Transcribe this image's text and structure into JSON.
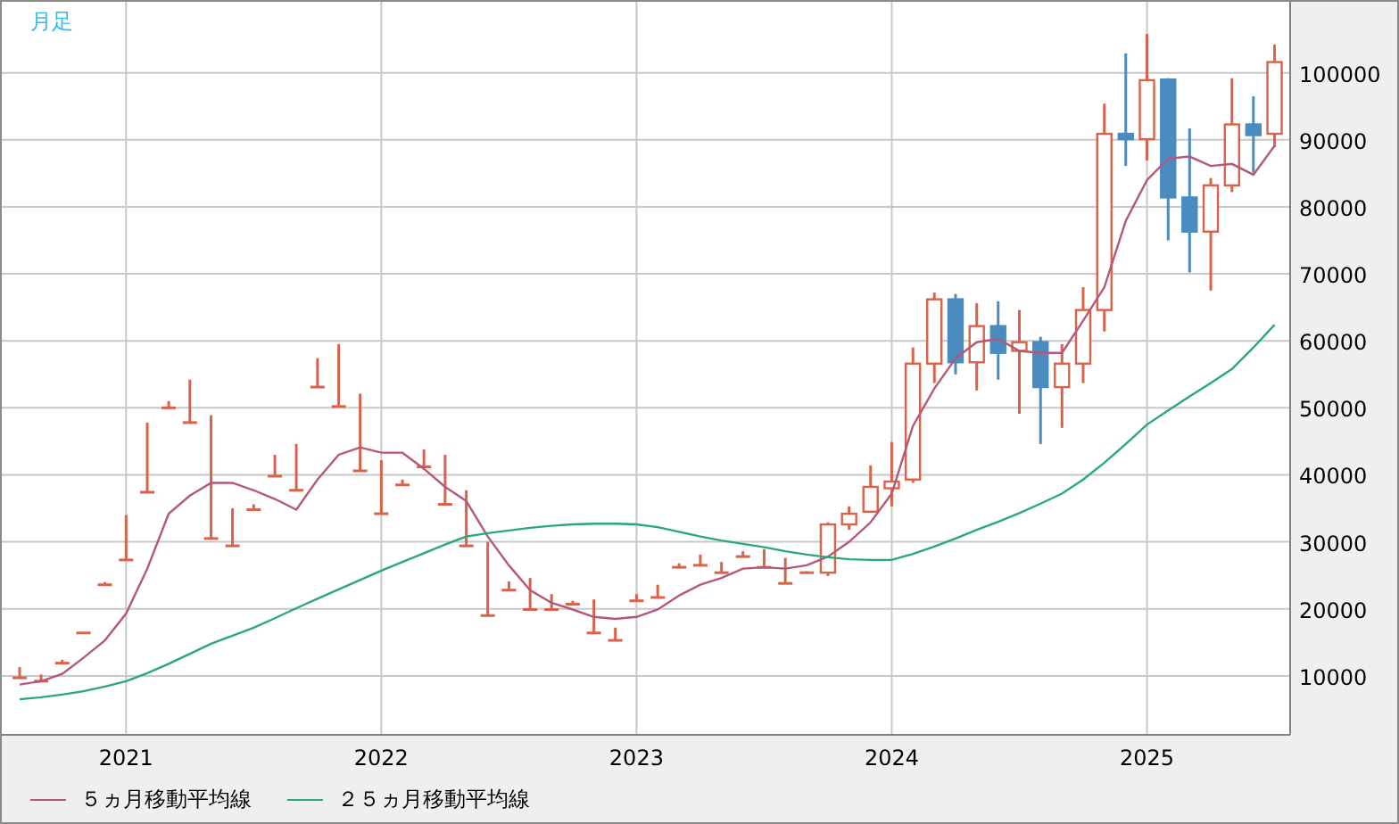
{
  "chart_title": "月足",
  "chart_data": {
    "type": "candlestick",
    "grid": true,
    "x": [
      2020.583,
      2020.667,
      2020.75,
      2020.833,
      2020.917,
      2021,
      2021.083,
      2021.167,
      2021.25,
      2021.333,
      2021.417,
      2021.5,
      2021.583,
      2021.667,
      2021.75,
      2021.833,
      2021.917,
      2022,
      2022.083,
      2022.167,
      2022.25,
      2022.333,
      2022.417,
      2022.5,
      2022.583,
      2022.667,
      2022.75,
      2022.833,
      2022.917,
      2023,
      2023.083,
      2023.167,
      2023.25,
      2023.333,
      2023.417,
      2023.5,
      2023.583,
      2023.667,
      2023.75,
      2023.833,
      2023.917,
      2024,
      2024.083,
      2024.167,
      2024.25,
      2024.333,
      2024.417,
      2024.5,
      2024.583,
      2024.667,
      2024.75,
      2024.833,
      2024.917,
      2025,
      2025.083,
      2025.167,
      2025.25,
      2025.333,
      2025.417,
      2025.5
    ],
    "ohlc": [
      [
        9700,
        11300,
        9700,
        9700
      ],
      [
        9200,
        10200,
        9200,
        9200
      ],
      [
        11900,
        12400,
        11900,
        11900
      ],
      [
        16400,
        16400,
        16400,
        16400
      ],
      [
        23600,
        24000,
        23600,
        23600
      ],
      [
        27300,
        34000,
        27300,
        27300
      ],
      [
        37400,
        47800,
        37400,
        37400
      ],
      [
        50000,
        51000,
        50000,
        50000
      ],
      [
        47800,
        54200,
        47800,
        47800
      ],
      [
        30500,
        48900,
        30500,
        30500
      ],
      [
        29400,
        35000,
        29400,
        29400
      ],
      [
        34800,
        35600,
        34800,
        34800
      ],
      [
        39800,
        43000,
        39800,
        39800
      ],
      [
        37700,
        44600,
        37700,
        37700
      ],
      [
        53100,
        57400,
        53100,
        53100
      ],
      [
        50200,
        59500,
        50200,
        50200
      ],
      [
        40600,
        52100,
        40600,
        40600
      ],
      [
        34200,
        42200,
        34200,
        34200
      ],
      [
        38500,
        39300,
        38500,
        38500
      ],
      [
        41200,
        43800,
        41200,
        41200
      ],
      [
        35600,
        43000,
        35600,
        35600
      ],
      [
        29400,
        37700,
        29400,
        29400
      ],
      [
        19000,
        30000,
        19000,
        19000
      ],
      [
        22800,
        24100,
        22800,
        22800
      ],
      [
        19900,
        24600,
        19900,
        19900
      ],
      [
        19900,
        22200,
        19900,
        19900
      ],
      [
        20700,
        21200,
        20700,
        20700
      ],
      [
        16400,
        21400,
        16400,
        16400
      ],
      [
        15300,
        17200,
        15300,
        15300
      ],
      [
        21200,
        22200,
        21200,
        21200
      ],
      [
        21700,
        23600,
        21700,
        21700
      ],
      [
        26200,
        26800,
        26200,
        26200
      ],
      [
        26500,
        28100,
        26500,
        26500
      ],
      [
        25400,
        27000,
        25400,
        25400
      ],
      [
        27800,
        28600,
        27800,
        27800
      ],
      [
        26200,
        28900,
        26200,
        26200
      ],
      [
        23800,
        27600,
        23800,
        23800
      ],
      [
        25400,
        25600,
        25400,
        25400
      ],
      [
        25400,
        32900,
        24900,
        32600
      ],
      [
        32600,
        35300,
        31800,
        34200
      ],
      [
        34500,
        41400,
        34500,
        38200
      ],
      [
        38000,
        44900,
        35300,
        39000
      ],
      [
        39300,
        59000,
        38800,
        56600
      ],
      [
        56600,
        67200,
        53700,
        66200
      ],
      [
        66200,
        67000,
        55000,
        56800
      ],
      [
        56800,
        65600,
        52600,
        62200
      ],
      [
        62200,
        65900,
        54200,
        58200
      ],
      [
        58500,
        64600,
        49100,
        59800
      ],
      [
        59800,
        60600,
        44600,
        53100
      ],
      [
        53100,
        59500,
        47000,
        56600
      ],
      [
        56600,
        68000,
        53700,
        64600
      ],
      [
        64600,
        95400,
        61400,
        90900
      ],
      [
        90900,
        102900,
        86100,
        90100
      ],
      [
        90100,
        105800,
        86900,
        98900
      ],
      [
        99000,
        99200,
        75000,
        81400
      ],
      [
        81400,
        91700,
        70200,
        76300
      ],
      [
        76300,
        84300,
        67500,
        83200
      ],
      [
        83200,
        99200,
        82200,
        92300
      ],
      [
        92300,
        96500,
        85100,
        90700
      ],
      [
        90900,
        104200,
        88900,
        101600
      ]
    ],
    "series": [
      {
        "name": "５ヵ月移動平均線",
        "type": "line",
        "color": "#b5577a",
        "values": [
          8700,
          9200,
          10300,
          12700,
          15300,
          19300,
          26000,
          34200,
          36900,
          38800,
          38800,
          37700,
          36400,
          34800,
          39300,
          43000,
          44100,
          43300,
          43300,
          40900,
          38200,
          36100,
          30800,
          26500,
          22800,
          20900,
          19900,
          18800,
          18500,
          18800,
          19900,
          22000,
          23600,
          24600,
          26000,
          26200,
          26000,
          26500,
          27800,
          30000,
          32900,
          37200,
          47300,
          52900,
          57400,
          59800,
          60300,
          58500,
          58200,
          58200,
          63000,
          68000,
          77900,
          84000,
          87200,
          87500,
          86100,
          86400,
          84800,
          89100
        ]
      },
      {
        "name": "２５ヵ月移動平均線",
        "type": "line",
        "color": "#2aa876",
        "values": [
          6500,
          6800,
          7200,
          7700,
          8400,
          9200,
          10400,
          11800,
          13300,
          14800,
          16000,
          17200,
          18600,
          20100,
          21500,
          22900,
          24300,
          25700,
          27000,
          28300,
          29600,
          30800,
          31300,
          31700,
          32100,
          32400,
          32600,
          32700,
          32700,
          32600,
          32200,
          31500,
          30800,
          30200,
          29700,
          29200,
          28600,
          28100,
          27700,
          27400,
          27300,
          27300,
          28200,
          29300,
          30500,
          31800,
          33000,
          34300,
          35700,
          37200,
          39300,
          41800,
          44600,
          47500,
          49600,
          51700,
          53700,
          55800,
          59000,
          62400
        ]
      }
    ],
    "xticks": [
      2021,
      2022,
      2023,
      2024,
      2025
    ],
    "yticks": [
      10000,
      20000,
      30000,
      40000,
      50000,
      60000,
      70000,
      80000,
      90000,
      100000
    ],
    "ylim": [
      1200,
      110600
    ],
    "xlim": [
      2020.513,
      2025.561
    ]
  }
}
